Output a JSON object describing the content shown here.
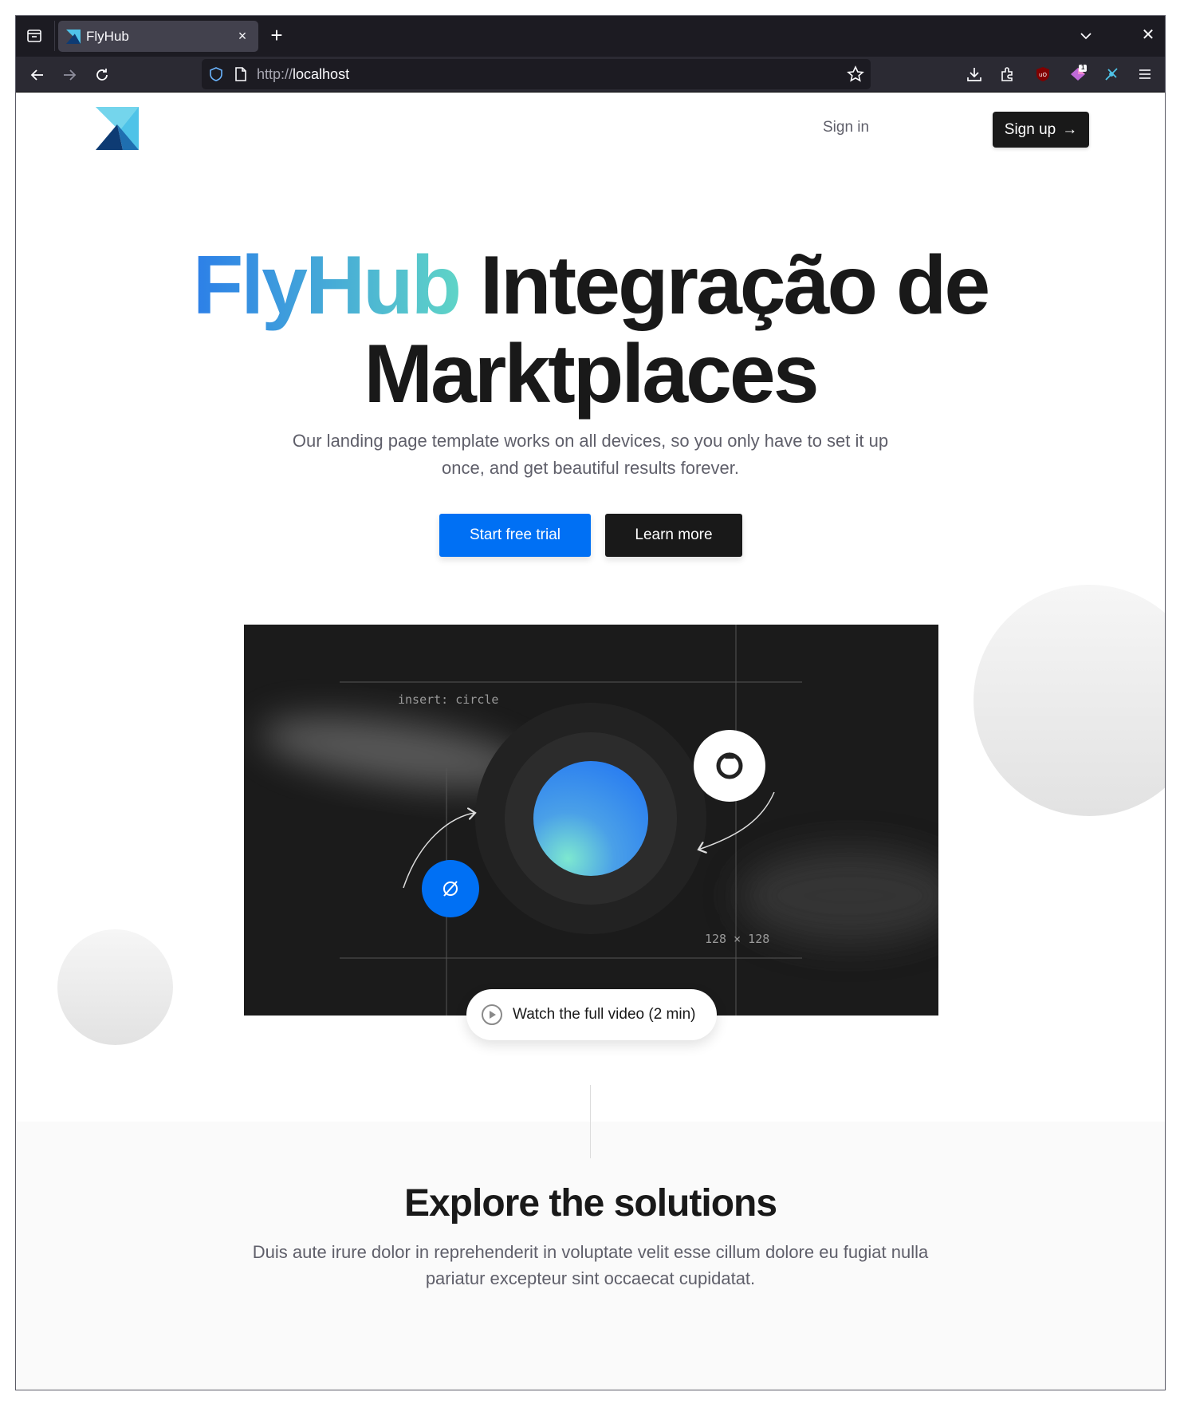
{
  "browser": {
    "tab_title": "FlyHub",
    "tab_close": "×",
    "new_tab": "+",
    "url_scheme": "http://",
    "url_host": "localhost",
    "badge_count": "1"
  },
  "header": {
    "signin_label": "Sign in",
    "signup_label": "Sign up",
    "signup_arrow": "→"
  },
  "hero": {
    "brand": "FlyHub",
    "title_rest": " Integração de",
    "title_line2": "Marktplaces",
    "subtitle": "Our landing page template works on all devices, so you only have to set it up once, and get beautiful results forever.",
    "cta_primary": "Start free trial",
    "cta_secondary": "Learn more"
  },
  "video": {
    "label_insert": "insert: circle",
    "label_size": "128 × 128",
    "watch_label": "Watch the full video (2 min)"
  },
  "solutions": {
    "title": "Explore the solutions",
    "subtitle": "Duis aute irure dolor in reprehenderit in voluptate velit esse cillum dolore eu fugiat nulla pariatur excepteur sint occaecat cupidatat."
  },
  "colors": {
    "accent_blue": "#0070f4",
    "dark": "#191919",
    "gradient_start": "#2c7fe8",
    "gradient_end": "#5fd4c7"
  }
}
